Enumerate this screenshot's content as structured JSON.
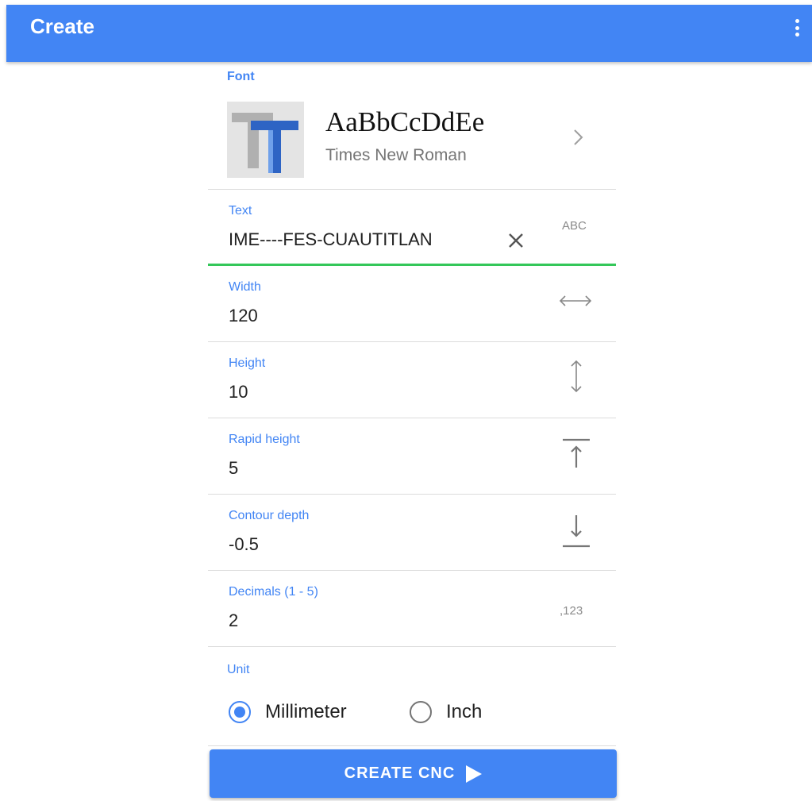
{
  "appbar": {
    "title": "Create",
    "menu_icon": "more-vert-icon"
  },
  "font": {
    "label": "Font",
    "sample": "AaBbCcDdEe",
    "name": "Times New Roman",
    "chevron_icon": "chevron-right-icon"
  },
  "fields": {
    "text": {
      "label": "Text",
      "value": "IME----FES-CUAUTITLAN",
      "clear_icon": "close-icon",
      "icon_text": "ABC",
      "underline_color": "#34c759"
    },
    "width": {
      "label": "Width",
      "value": "120",
      "icon": "horizontal-arrows-icon"
    },
    "height": {
      "label": "Height",
      "value": "10",
      "icon": "vertical-arrows-icon"
    },
    "rapid_height": {
      "label": "Rapid height",
      "value": "5",
      "icon": "arrow-up-to-line-icon"
    },
    "contour_depth": {
      "label": "Contour depth",
      "value": "-0.5",
      "icon": "arrow-down-to-line-icon"
    },
    "decimals": {
      "label": "Decimals (1 - 5)",
      "value": "2",
      "icon_text": ",123"
    }
  },
  "unit": {
    "label": "Unit",
    "options": [
      {
        "label": "Millimeter",
        "selected": true
      },
      {
        "label": "Inch",
        "selected": false
      }
    ]
  },
  "create_button": {
    "label": "CREATE CNC",
    "icon": "play-icon"
  },
  "colors": {
    "accent": "#4285f4",
    "active_underline": "#34c759",
    "divider": "#dcdcdc"
  }
}
